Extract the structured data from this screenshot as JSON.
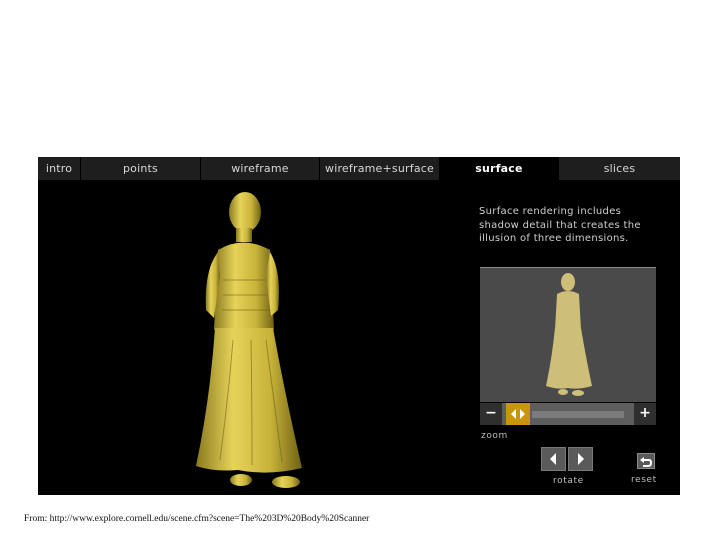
{
  "tabs": [
    {
      "label": "intro"
    },
    {
      "label": "points"
    },
    {
      "label": "wireframe"
    },
    {
      "label": "wireframe+surface"
    },
    {
      "label": "surface",
      "active": true
    },
    {
      "label": "slices"
    }
  ],
  "description": "Surface rendering includes shadow detail that creates the illusion of three dimensions.",
  "controls": {
    "zoom_label": "zoom",
    "zoom_out_symbol": "−",
    "zoom_in_symbol": "+",
    "rotate_label": "rotate",
    "reset_label": "reset",
    "icons": {
      "rotate_left": "triangle-left-icon",
      "rotate_right": "triangle-right-icon",
      "reset": "undo-arrow-icon",
      "zoom_handle": "left-right-arrows-icon"
    }
  },
  "colors": {
    "figure": "#d8c24a",
    "accent": "#c8960c",
    "panel": "#000000"
  },
  "caption": "From: http://www.explore.cornell.edu/scene.cfm?scene=The%203D%20Body%20Scanner"
}
